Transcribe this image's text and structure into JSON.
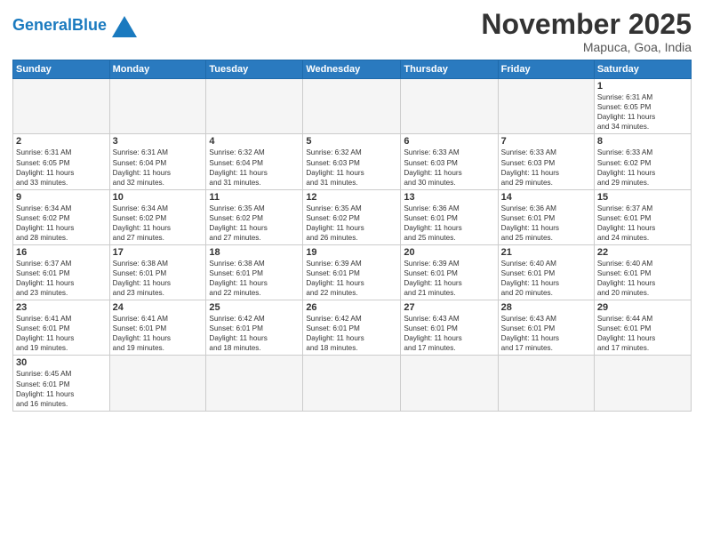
{
  "header": {
    "logo_general": "General",
    "logo_blue": "Blue",
    "month_title": "November 2025",
    "location": "Mapuca, Goa, India"
  },
  "days_of_week": [
    "Sunday",
    "Monday",
    "Tuesday",
    "Wednesday",
    "Thursday",
    "Friday",
    "Saturday"
  ],
  "weeks": [
    [
      {
        "num": "",
        "info": ""
      },
      {
        "num": "",
        "info": ""
      },
      {
        "num": "",
        "info": ""
      },
      {
        "num": "",
        "info": ""
      },
      {
        "num": "",
        "info": ""
      },
      {
        "num": "",
        "info": ""
      },
      {
        "num": "1",
        "info": "Sunrise: 6:31 AM\nSunset: 6:05 PM\nDaylight: 11 hours\nand 34 minutes."
      }
    ],
    [
      {
        "num": "2",
        "info": "Sunrise: 6:31 AM\nSunset: 6:05 PM\nDaylight: 11 hours\nand 33 minutes."
      },
      {
        "num": "3",
        "info": "Sunrise: 6:31 AM\nSunset: 6:04 PM\nDaylight: 11 hours\nand 32 minutes."
      },
      {
        "num": "4",
        "info": "Sunrise: 6:32 AM\nSunset: 6:04 PM\nDaylight: 11 hours\nand 31 minutes."
      },
      {
        "num": "5",
        "info": "Sunrise: 6:32 AM\nSunset: 6:03 PM\nDaylight: 11 hours\nand 31 minutes."
      },
      {
        "num": "6",
        "info": "Sunrise: 6:33 AM\nSunset: 6:03 PM\nDaylight: 11 hours\nand 30 minutes."
      },
      {
        "num": "7",
        "info": "Sunrise: 6:33 AM\nSunset: 6:03 PM\nDaylight: 11 hours\nand 29 minutes."
      },
      {
        "num": "8",
        "info": "Sunrise: 6:33 AM\nSunset: 6:02 PM\nDaylight: 11 hours\nand 29 minutes."
      }
    ],
    [
      {
        "num": "9",
        "info": "Sunrise: 6:34 AM\nSunset: 6:02 PM\nDaylight: 11 hours\nand 28 minutes."
      },
      {
        "num": "10",
        "info": "Sunrise: 6:34 AM\nSunset: 6:02 PM\nDaylight: 11 hours\nand 27 minutes."
      },
      {
        "num": "11",
        "info": "Sunrise: 6:35 AM\nSunset: 6:02 PM\nDaylight: 11 hours\nand 27 minutes."
      },
      {
        "num": "12",
        "info": "Sunrise: 6:35 AM\nSunset: 6:02 PM\nDaylight: 11 hours\nand 26 minutes."
      },
      {
        "num": "13",
        "info": "Sunrise: 6:36 AM\nSunset: 6:01 PM\nDaylight: 11 hours\nand 25 minutes."
      },
      {
        "num": "14",
        "info": "Sunrise: 6:36 AM\nSunset: 6:01 PM\nDaylight: 11 hours\nand 25 minutes."
      },
      {
        "num": "15",
        "info": "Sunrise: 6:37 AM\nSunset: 6:01 PM\nDaylight: 11 hours\nand 24 minutes."
      }
    ],
    [
      {
        "num": "16",
        "info": "Sunrise: 6:37 AM\nSunset: 6:01 PM\nDaylight: 11 hours\nand 23 minutes."
      },
      {
        "num": "17",
        "info": "Sunrise: 6:38 AM\nSunset: 6:01 PM\nDaylight: 11 hours\nand 23 minutes."
      },
      {
        "num": "18",
        "info": "Sunrise: 6:38 AM\nSunset: 6:01 PM\nDaylight: 11 hours\nand 22 minutes."
      },
      {
        "num": "19",
        "info": "Sunrise: 6:39 AM\nSunset: 6:01 PM\nDaylight: 11 hours\nand 22 minutes."
      },
      {
        "num": "20",
        "info": "Sunrise: 6:39 AM\nSunset: 6:01 PM\nDaylight: 11 hours\nand 21 minutes."
      },
      {
        "num": "21",
        "info": "Sunrise: 6:40 AM\nSunset: 6:01 PM\nDaylight: 11 hours\nand 20 minutes."
      },
      {
        "num": "22",
        "info": "Sunrise: 6:40 AM\nSunset: 6:01 PM\nDaylight: 11 hours\nand 20 minutes."
      }
    ],
    [
      {
        "num": "23",
        "info": "Sunrise: 6:41 AM\nSunset: 6:01 PM\nDaylight: 11 hours\nand 19 minutes."
      },
      {
        "num": "24",
        "info": "Sunrise: 6:41 AM\nSunset: 6:01 PM\nDaylight: 11 hours\nand 19 minutes."
      },
      {
        "num": "25",
        "info": "Sunrise: 6:42 AM\nSunset: 6:01 PM\nDaylight: 11 hours\nand 18 minutes."
      },
      {
        "num": "26",
        "info": "Sunrise: 6:42 AM\nSunset: 6:01 PM\nDaylight: 11 hours\nand 18 minutes."
      },
      {
        "num": "27",
        "info": "Sunrise: 6:43 AM\nSunset: 6:01 PM\nDaylight: 11 hours\nand 17 minutes."
      },
      {
        "num": "28",
        "info": "Sunrise: 6:43 AM\nSunset: 6:01 PM\nDaylight: 11 hours\nand 17 minutes."
      },
      {
        "num": "29",
        "info": "Sunrise: 6:44 AM\nSunset: 6:01 PM\nDaylight: 11 hours\nand 17 minutes."
      }
    ],
    [
      {
        "num": "30",
        "info": "Sunrise: 6:45 AM\nSunset: 6:01 PM\nDaylight: 11 hours\nand 16 minutes."
      },
      {
        "num": "",
        "info": ""
      },
      {
        "num": "",
        "info": ""
      },
      {
        "num": "",
        "info": ""
      },
      {
        "num": "",
        "info": ""
      },
      {
        "num": "",
        "info": ""
      },
      {
        "num": "",
        "info": ""
      }
    ]
  ]
}
